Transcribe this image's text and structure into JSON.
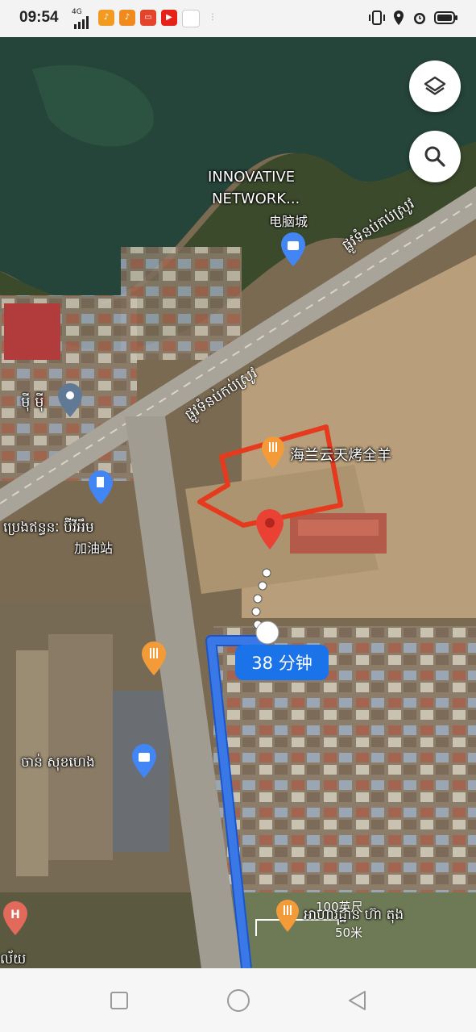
{
  "status_bar": {
    "time": "09:54",
    "network": "4G",
    "right_icons": [
      "vibrate-icon",
      "location-icon",
      "alarm-icon",
      "battery-icon"
    ]
  },
  "map": {
    "place_label_1": "INNOVATIVE",
    "place_label_2": "NETWORK...",
    "place_label_3": "电脑城",
    "road_label_1": "ផ្លូវទំនប់កប់ស្រូវ",
    "road_label_2": "ផ្លូវទំនប់កប់ស្រូវ",
    "place_mi": "ម៉ី ម៉ី",
    "restaurant_label": "海兰云天烤全羊",
    "gas_label_1": "ប្រេងឥន្ធនៈ ប៊ីវីអឹម",
    "gas_label_2": "加油站",
    "shop_label": "ចាន់ សុខហេង",
    "hospital_label": "ល័យ",
    "bottom_label": "អាហារដ្ឋាន ហ៊ា តុង",
    "eta": "38 分钟",
    "scale_feet": "100英尺",
    "scale_meters": "50米",
    "colors": {
      "route": "#3b78e7",
      "marker": "#e94235",
      "highlight": "#e53a1e"
    }
  }
}
